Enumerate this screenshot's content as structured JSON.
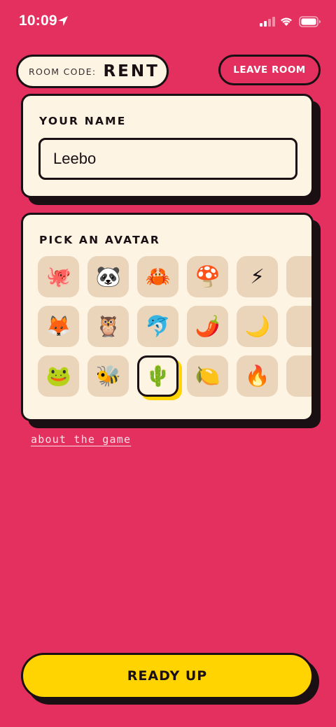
{
  "status_bar": {
    "time": "10:09",
    "icons": [
      "location-arrow-icon",
      "cellular-signal-icon",
      "wifi-icon",
      "battery-icon"
    ]
  },
  "header": {
    "room_code_label": "ROOM CODE:",
    "room_code_value": "RENT",
    "leave_button": "LEAVE ROOM"
  },
  "name_card": {
    "heading": "YOUR NAME",
    "input_value": "Leebo"
  },
  "avatar_card": {
    "heading": "PICK AN AVATAR",
    "selected_index": 12,
    "rows": [
      [
        "🐙",
        "🐼",
        "🦀",
        "🍄",
        "⚡",
        ""
      ],
      [
        "🦊",
        "🦉",
        "🐬",
        "🌶️",
        "🌙",
        ""
      ],
      [
        "🐸",
        "🐝",
        "🌵",
        "🍋",
        "🔥",
        ""
      ]
    ]
  },
  "footer": {
    "about_link": "about the game",
    "ready_button": "READY UP"
  },
  "colors": {
    "background": "#E4305F",
    "card": "#FDF4E3",
    "tile": "#EAD5BB",
    "accent_yellow": "#FFD400",
    "ink": "#1a1014"
  }
}
